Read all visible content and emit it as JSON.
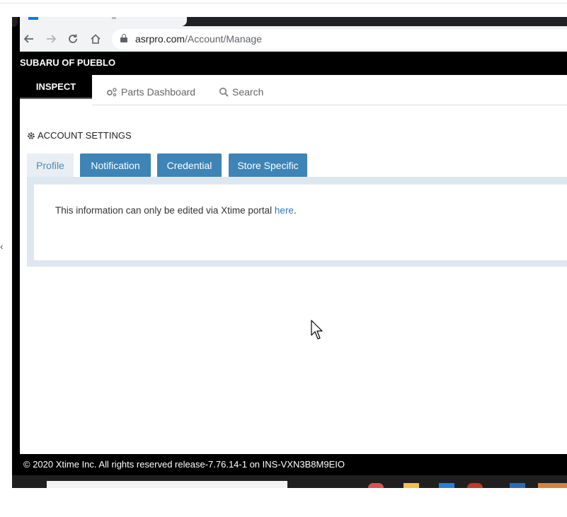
{
  "browser": {
    "url_domain": "asrpro.com",
    "url_path": "/Account/Manage",
    "nav_icons": [
      "back-arrow-icon",
      "forward-arrow-icon",
      "reload-icon",
      "home-icon",
      "lock-icon"
    ]
  },
  "app": {
    "dealer_name": "SUBARU OF PUEBLO",
    "inspect_tab": "INSPECT",
    "nav": [
      {
        "label": "Parts Dashboard",
        "icon": "gears-icon"
      },
      {
        "label": "Search",
        "icon": "search-icon"
      }
    ]
  },
  "account": {
    "title": "ACCOUNT SETTINGS",
    "title_icon": "gear-icon",
    "tabs": [
      {
        "label": "Profile",
        "active": true
      },
      {
        "label": "Notification",
        "active": false
      },
      {
        "label": "Credential",
        "active": false
      },
      {
        "label": "Store Specific",
        "active": false
      }
    ],
    "info_text": "This information can only be edited via Xtime portal ",
    "info_link": "here",
    "info_end": "."
  },
  "footer": {
    "text": "© 2020 Xtime Inc. All rights reserved release-7.76.14-1 on INS-VXN3B8M9EIO"
  },
  "colors": {
    "accent_blue": "#3f84b6",
    "link_blue": "#337ab7",
    "active_tab_bg": "#e8eef3",
    "header_black": "#000000"
  }
}
